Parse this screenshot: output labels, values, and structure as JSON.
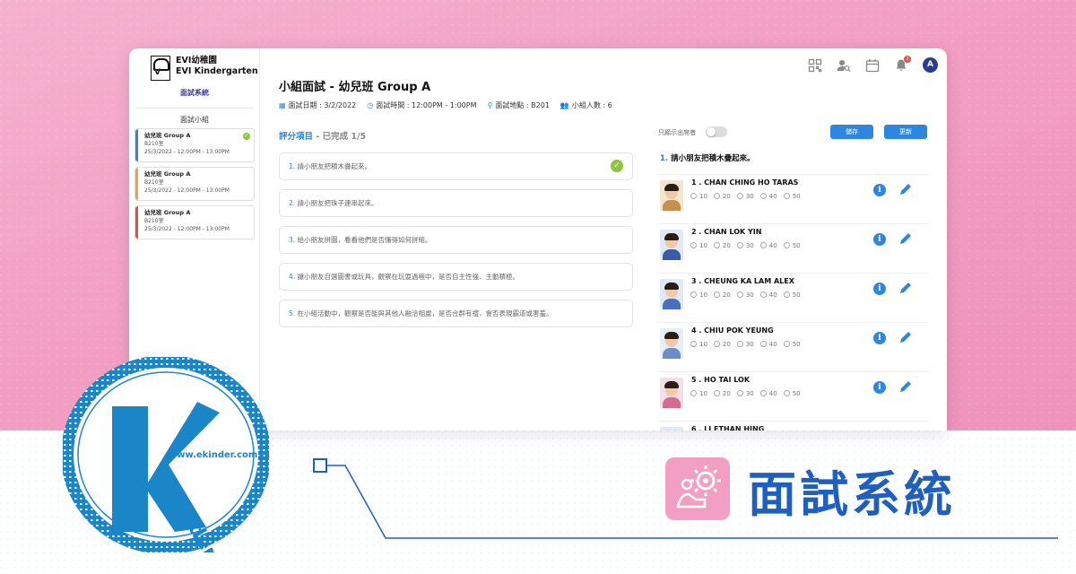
{
  "school": {
    "name_zh": "EVI幼稚園",
    "name_en": "EVI Kindergarten",
    "system": "面試系統"
  },
  "sidebar": {
    "title": "面試小組",
    "groups": [
      {
        "name": "幼兒班 Group A",
        "room": "B210室",
        "time": "25/3/2022 - 12:00PM - 13:00PM",
        "color": "#2e86de",
        "done": true
      },
      {
        "name": "幼兒班 Group A",
        "room": "B210室",
        "time": "25/3/2022 - 12:00PM - 13:00PM",
        "color": "#f0a04b",
        "done": false
      },
      {
        "name": "幼兒班 Group A",
        "room": "B210室",
        "time": "25/3/2022 - 12:00PM - 13:00PM",
        "color": "#e74c3c",
        "done": false
      }
    ]
  },
  "header": {
    "notif_count": "2",
    "avatar": "A"
  },
  "page": {
    "title": "小組面試 - 幼兒班 Group A",
    "date": "面試日期 : 3/2/2022",
    "time": "面試時間 : 12:00PM - 1:00PM",
    "location": "面試地點 : B201",
    "count": "小組人數 : 6"
  },
  "score": {
    "head_a": "評分項目",
    "head_b": " - 已完成 1/5",
    "questions": [
      {
        "num": "1.",
        "text": " 請小朋友把積木疊起來。",
        "done": true
      },
      {
        "num": "2.",
        "text": " 請小朋友把珠子連串起來。",
        "done": false
      },
      {
        "num": "3.",
        "text": " 給小朋友拼圖，看看他們是否懂得如何拼組。",
        "done": false
      },
      {
        "num": "4.",
        "text": " 讓小朋友自選圖書或玩具，觀察在玩耍過程中，是否自主性強、主動積極。",
        "done": false
      },
      {
        "num": "5.",
        "text": " 在小組活動中，觀察是否能與其他人融洽相處，是否合群有禮，會否表現霸道或害羞。",
        "done": false
      }
    ]
  },
  "right": {
    "toggle_label": "只顯示出席者",
    "btn_save": "儲存",
    "btn_update": "更新",
    "question_num": "1.",
    "question_text": " 請小朋友把積木疊起來。",
    "score_options": [
      "10",
      "20",
      "30",
      "40",
      "50"
    ],
    "students": [
      {
        "name": "1 . CHAN CHING HO TARAS",
        "bg": "#f3e6cf",
        "shirt": "#c98f4c"
      },
      {
        "name": "2 . CHAN LOK YIN",
        "bg": "#dfe9f7",
        "shirt": "#3b5ba7"
      },
      {
        "name": "3 . CHEUNG KA LAM ALEX",
        "bg": "#dfe9f7",
        "shirt": "#4a6fc0"
      },
      {
        "name": "4 . CHIU POK YEUNG",
        "bg": "#e6eef8",
        "shirt": "#6d8ccc"
      },
      {
        "name": "5 . HO TAI LOK",
        "bg": "#f2dfe8",
        "shirt": "#d76b8f"
      },
      {
        "name": "6 . LI ETHAN HING",
        "bg": "#dfe9f7",
        "shirt": "#3b5ba7"
      }
    ]
  },
  "stamp": {
    "url": "www.ekinder.com.hk",
    "word": "inder"
  },
  "banner": {
    "title": "面試系統"
  }
}
